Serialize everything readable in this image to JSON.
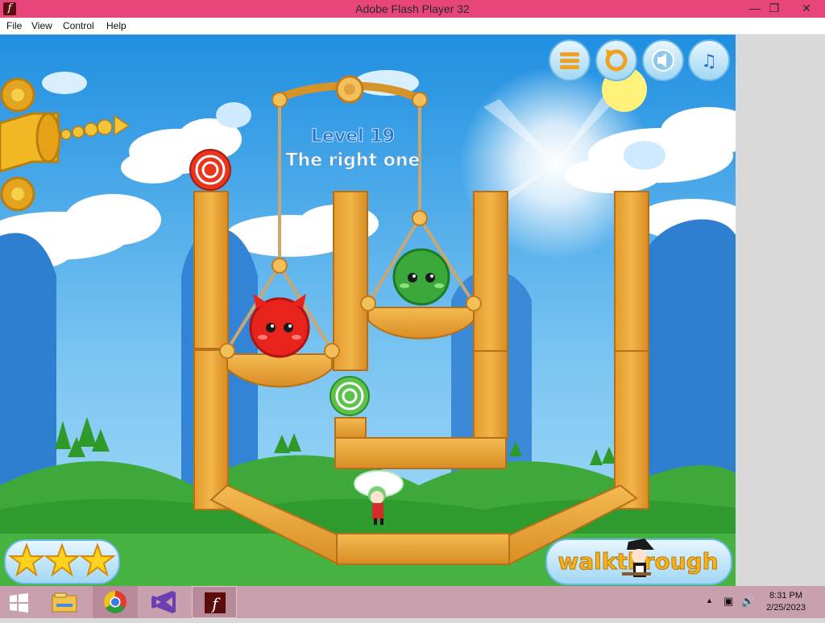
{
  "window": {
    "title": "Adobe Flash Player 32",
    "minimize_icon": "minimize-icon",
    "restore_icon": "restore-icon",
    "close_icon": "close-icon"
  },
  "menu": {
    "file": "File",
    "view": "View",
    "control": "Control",
    "help": "Help"
  },
  "game": {
    "level_label": "Level 19",
    "level_name": "The right one",
    "walkthrough_label": "walkthrough",
    "stars_earned": 3,
    "toolbar_icons": [
      "menu-icon",
      "restart-icon",
      "sound-icon",
      "music-icon"
    ],
    "colors": {
      "sky": "#3aa0e6",
      "wood": "#e8a23a",
      "grass": "#3fae3a",
      "red_monster": "#e8231c",
      "green_monster": "#3aa83a"
    }
  },
  "taskbar": {
    "apps": [
      "windows-start-icon",
      "file-explorer-icon",
      "chrome-icon",
      "visual-studio-icon",
      "flash-player-icon"
    ],
    "clock": {
      "time": "8:31 PM",
      "date": "2/25/2023"
    }
  }
}
